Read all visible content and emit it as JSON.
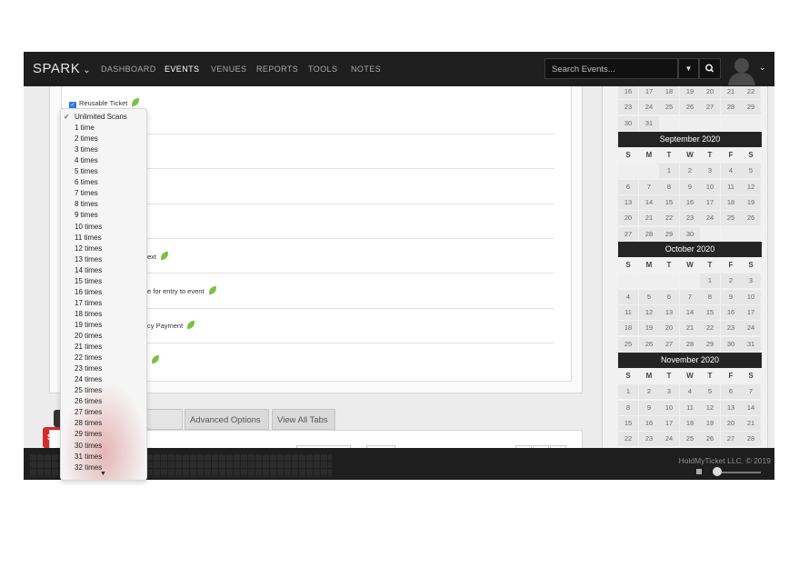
{
  "nav": {
    "brand": "SPARK",
    "items": [
      "DASHBOARD",
      "EVENTS",
      "VENUES",
      "REPORTS",
      "TOOLS",
      "NOTES"
    ],
    "active": "EVENTS",
    "search_placeholder": "Search Events..."
  },
  "form": {
    "reusable_label": "Reusable Ticket",
    "partial_rows": [
      "ext",
      "e for entry to event",
      "cy Payment"
    ]
  },
  "tabs": [
    "ket Text",
    "Advanced Options",
    "View All Tabs"
  ],
  "save_partial": "SA",
  "dropdown": {
    "selected": "Unlimited Scans",
    "options": [
      "Unlimited Scans",
      "1 time",
      "2 times",
      "3 times",
      "4 times",
      "5 times",
      "6 times",
      "7 times",
      "8 times",
      "9 times",
      "10 times",
      "11 times",
      "12 times",
      "13 times",
      "14 times",
      "15 times",
      "16 times",
      "17 times",
      "18 times",
      "19 times",
      "20 times",
      "21 times",
      "22 times",
      "23 times",
      "24 times",
      "25 times",
      "26 times",
      "27 times",
      "28 times",
      "29 times",
      "30 times",
      "31 times",
      "32 times"
    ]
  },
  "footer": {
    "copyright": "HoldMyTicket LLC. © 2019"
  },
  "calendar": {
    "dow": [
      "S",
      "M",
      "T",
      "W",
      "T",
      "F",
      "S"
    ],
    "august_tail": [
      [
        "16",
        "17",
        "18",
        "19",
        "20",
        "21",
        "22"
      ],
      [
        "23",
        "24",
        "25",
        "26",
        "27",
        "28",
        "29"
      ],
      [
        "30",
        "31",
        "",
        "",
        "",
        "",
        ""
      ]
    ],
    "months": [
      {
        "name": "September 2020",
        "weeks": [
          [
            "",
            "",
            "1",
            "2",
            "3",
            "4",
            "5"
          ],
          [
            "6",
            "7",
            "8",
            "9",
            "10",
            "11",
            "12"
          ],
          [
            "13",
            "14",
            "15",
            "16",
            "17",
            "18",
            "19"
          ],
          [
            "20",
            "21",
            "22",
            "23",
            "24",
            "25",
            "26"
          ],
          [
            "27",
            "28",
            "29",
            "30",
            "",
            "",
            ""
          ]
        ]
      },
      {
        "name": "October 2020",
        "weeks": [
          [
            "",
            "",
            "",
            "",
            "1",
            "2",
            "3"
          ],
          [
            "4",
            "5",
            "6",
            "7",
            "8",
            "9",
            "10"
          ],
          [
            "11",
            "12",
            "13",
            "14",
            "15",
            "16",
            "17"
          ],
          [
            "18",
            "19",
            "20",
            "21",
            "22",
            "23",
            "24"
          ],
          [
            "25",
            "26",
            "27",
            "28",
            "29",
            "30",
            "31"
          ]
        ]
      },
      {
        "name": "November 2020",
        "weeks": [
          [
            "1",
            "2",
            "3",
            "4",
            "5",
            "6",
            "7"
          ],
          [
            "8",
            "9",
            "10",
            "11",
            "12",
            "13",
            "14"
          ],
          [
            "15",
            "16",
            "17",
            "18",
            "19",
            "20",
            "21"
          ],
          [
            "22",
            "23",
            "24",
            "25",
            "26",
            "27",
            "28"
          ]
        ]
      }
    ]
  },
  "colors": {
    "nav_bg": "#1e1e1e",
    "checkbox": "#2f7be0",
    "leaf": "#7cc144",
    "save_red": "#d22d2d"
  }
}
